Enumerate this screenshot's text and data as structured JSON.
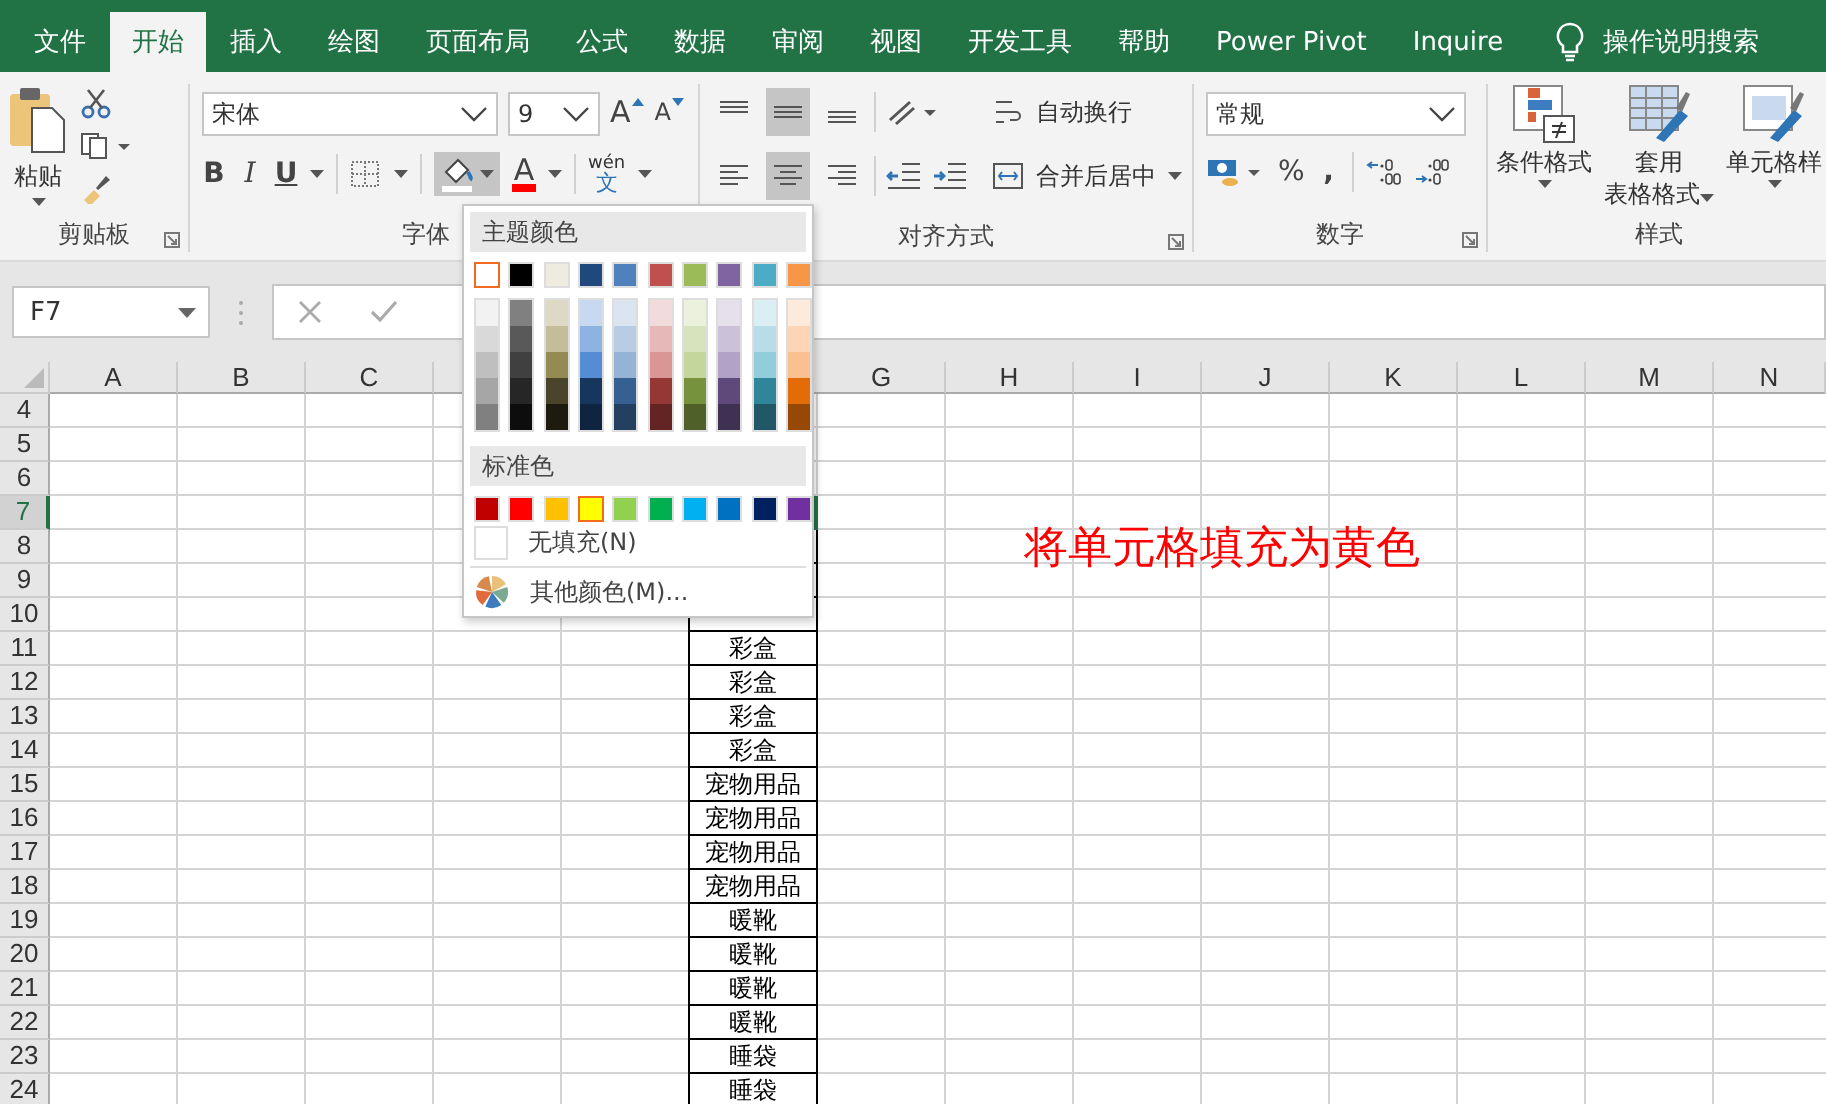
{
  "tabs": [
    {
      "label": "文件",
      "selected": false
    },
    {
      "label": "开始",
      "selected": true
    },
    {
      "label": "插入",
      "selected": false
    },
    {
      "label": "绘图",
      "selected": false
    },
    {
      "label": "页面布局",
      "selected": false
    },
    {
      "label": "公式",
      "selected": false
    },
    {
      "label": "数据",
      "selected": false
    },
    {
      "label": "审阅",
      "selected": false
    },
    {
      "label": "视图",
      "selected": false
    },
    {
      "label": "开发工具",
      "selected": false
    },
    {
      "label": "帮助",
      "selected": false
    },
    {
      "label": "Power Pivot",
      "selected": false
    },
    {
      "label": "Inquire",
      "selected": false
    }
  ],
  "search": {
    "label": "操作说明搜索"
  },
  "clipboard": {
    "paste": "粘贴",
    "group": "剪贴板"
  },
  "font": {
    "name": "宋体",
    "size": "9",
    "grow": "A",
    "shrink": "A",
    "bold": "B",
    "italic": "I",
    "underline": "U",
    "font_color": "A",
    "phonetic_top": "wén",
    "phonetic_bottom": "文",
    "fill_pressed": true,
    "group": "字体"
  },
  "alignment": {
    "vertical": [
      {
        "selected": false
      },
      {
        "selected": true
      },
      {
        "selected": false
      }
    ],
    "horizontal": [
      {
        "selected": false
      },
      {
        "selected": true
      },
      {
        "selected": false
      }
    ],
    "wrap": "自动换行",
    "merge": "合并后居中",
    "group": "对齐方式"
  },
  "number": {
    "format": "常规",
    "percent": "%",
    "comma": ",",
    "group": "数字"
  },
  "styles": {
    "conditional": "条件格式",
    "table_1": "套用",
    "table_2": "表格格式",
    "cell": "单元格样",
    "group": "样式"
  },
  "name_box": "F7",
  "columns": [
    {
      "label": "A"
    },
    {
      "label": "B"
    },
    {
      "label": "C"
    },
    {},
    {},
    {},
    {
      "label": "G"
    },
    {
      "label": "H"
    },
    {
      "label": "I"
    },
    {
      "label": "J"
    },
    {
      "label": "K"
    },
    {
      "label": "L"
    },
    {
      "label": "M"
    },
    {
      "label": "N"
    }
  ],
  "rows": [
    {
      "number": "4",
      "selected": false,
      "boxed": false
    },
    {
      "number": "5",
      "selected": false,
      "boxed": false
    },
    {
      "number": "6",
      "selected": false,
      "boxed": false
    },
    {
      "number": "7",
      "selected": true,
      "boxed": true
    },
    {
      "number": "8",
      "selected": false,
      "boxed": true
    },
    {
      "number": "9",
      "selected": false,
      "boxed": true
    },
    {
      "number": "10",
      "selected": false,
      "boxed": true
    },
    {
      "number": "11",
      "selected": false,
      "boxed": true,
      "f": "彩盒"
    },
    {
      "number": "12",
      "selected": false,
      "boxed": true,
      "f": "彩盒"
    },
    {
      "number": "13",
      "selected": false,
      "boxed": true,
      "f": "彩盒"
    },
    {
      "number": "14",
      "selected": false,
      "boxed": true,
      "f": "彩盒"
    },
    {
      "number": "15",
      "selected": false,
      "boxed": true,
      "f": "宠物用品"
    },
    {
      "number": "16",
      "selected": false,
      "boxed": true,
      "f": "宠物用品"
    },
    {
      "number": "17",
      "selected": false,
      "boxed": true,
      "f": "宠物用品"
    },
    {
      "number": "18",
      "selected": false,
      "boxed": true,
      "f": "宠物用品"
    },
    {
      "number": "19",
      "selected": false,
      "boxed": true,
      "f": "暖靴"
    },
    {
      "number": "20",
      "selected": false,
      "boxed": true,
      "f": "暖靴"
    },
    {
      "number": "21",
      "selected": false,
      "boxed": true,
      "f": "暖靴"
    },
    {
      "number": "22",
      "selected": false,
      "boxed": true,
      "f": "暖靴"
    },
    {
      "number": "23",
      "selected": false,
      "boxed": true,
      "f": "睡袋"
    },
    {
      "number": "24",
      "selected": false,
      "boxed": true,
      "f": "睡袋"
    }
  ],
  "note": "将单元格填充为黄色",
  "color_menu": {
    "theme_header": "主题颜色",
    "theme_colors": [
      {
        "color": "#ffffff",
        "selected": true,
        "shades": [
          {
            "color": "#f2f2f2"
          },
          {
            "color": "#d9d9d9"
          },
          {
            "color": "#bfbfbf"
          },
          {
            "color": "#a6a6a6"
          },
          {
            "color": "#808080"
          }
        ]
      },
      {
        "color": "#000000",
        "selected": false,
        "shades": [
          {
            "color": "#808080"
          },
          {
            "color": "#595959"
          },
          {
            "color": "#404040"
          },
          {
            "color": "#262626"
          },
          {
            "color": "#0d0d0d"
          }
        ]
      },
      {
        "color": "#eeece1",
        "selected": false,
        "shades": [
          {
            "color": "#ddd9c4"
          },
          {
            "color": "#c4bd97"
          },
          {
            "color": "#948a54"
          },
          {
            "color": "#4a452a"
          },
          {
            "color": "#1d1b10"
          }
        ]
      },
      {
        "color": "#1f497d",
        "selected": false,
        "shades": [
          {
            "color": "#c6d9f0"
          },
          {
            "color": "#8db3e2"
          },
          {
            "color": "#548dd4"
          },
          {
            "color": "#17365d"
          },
          {
            "color": "#0f243e"
          }
        ]
      },
      {
        "color": "#4f81bd",
        "selected": false,
        "shades": [
          {
            "color": "#dbe5f1"
          },
          {
            "color": "#b8cce4"
          },
          {
            "color": "#95b3d7"
          },
          {
            "color": "#366092"
          },
          {
            "color": "#244061"
          }
        ]
      },
      {
        "color": "#c0504d",
        "selected": false,
        "shades": [
          {
            "color": "#f2dcdb"
          },
          {
            "color": "#e6b9b8"
          },
          {
            "color": "#d99694"
          },
          {
            "color": "#953734"
          },
          {
            "color": "#632423"
          }
        ]
      },
      {
        "color": "#9bbb59",
        "selected": false,
        "shades": [
          {
            "color": "#ebf1dd"
          },
          {
            "color": "#d7e3bc"
          },
          {
            "color": "#c3d69b"
          },
          {
            "color": "#76923c"
          },
          {
            "color": "#4f6128"
          }
        ]
      },
      {
        "color": "#8064a2",
        "selected": false,
        "shades": [
          {
            "color": "#e5e0ec"
          },
          {
            "color": "#ccc1d9"
          },
          {
            "color": "#b2a2c7"
          },
          {
            "color": "#5f497a"
          },
          {
            "color": "#3f3151"
          }
        ]
      },
      {
        "color": "#4bacc6",
        "selected": false,
        "shades": [
          {
            "color": "#dbeef3"
          },
          {
            "color": "#b7dde8"
          },
          {
            "color": "#92cddc"
          },
          {
            "color": "#31859b"
          },
          {
            "color": "#205867"
          }
        ]
      },
      {
        "color": "#f79646",
        "selected": false,
        "shades": [
          {
            "color": "#fdeada"
          },
          {
            "color": "#fbd5b5"
          },
          {
            "color": "#fac08f"
          },
          {
            "color": "#e36c09"
          },
          {
            "color": "#974806"
          }
        ]
      }
    ],
    "standard_header": "标准色",
    "standard_colors": [
      {
        "color": "#c00000",
        "selected": false
      },
      {
        "color": "#ff0000",
        "selected": false
      },
      {
        "color": "#ffc000",
        "selected": false
      },
      {
        "color": "#ffff00",
        "selected": true
      },
      {
        "color": "#92d050",
        "selected": false
      },
      {
        "color": "#00b050",
        "selected": false
      },
      {
        "color": "#00b0f0",
        "selected": false
      },
      {
        "color": "#0070c0",
        "selected": false
      },
      {
        "color": "#002060",
        "selected": false
      },
      {
        "color": "#7030a0",
        "selected": false
      }
    ],
    "no_fill": "无填充(N)",
    "more_colors": "其他颜色(M)..."
  }
}
